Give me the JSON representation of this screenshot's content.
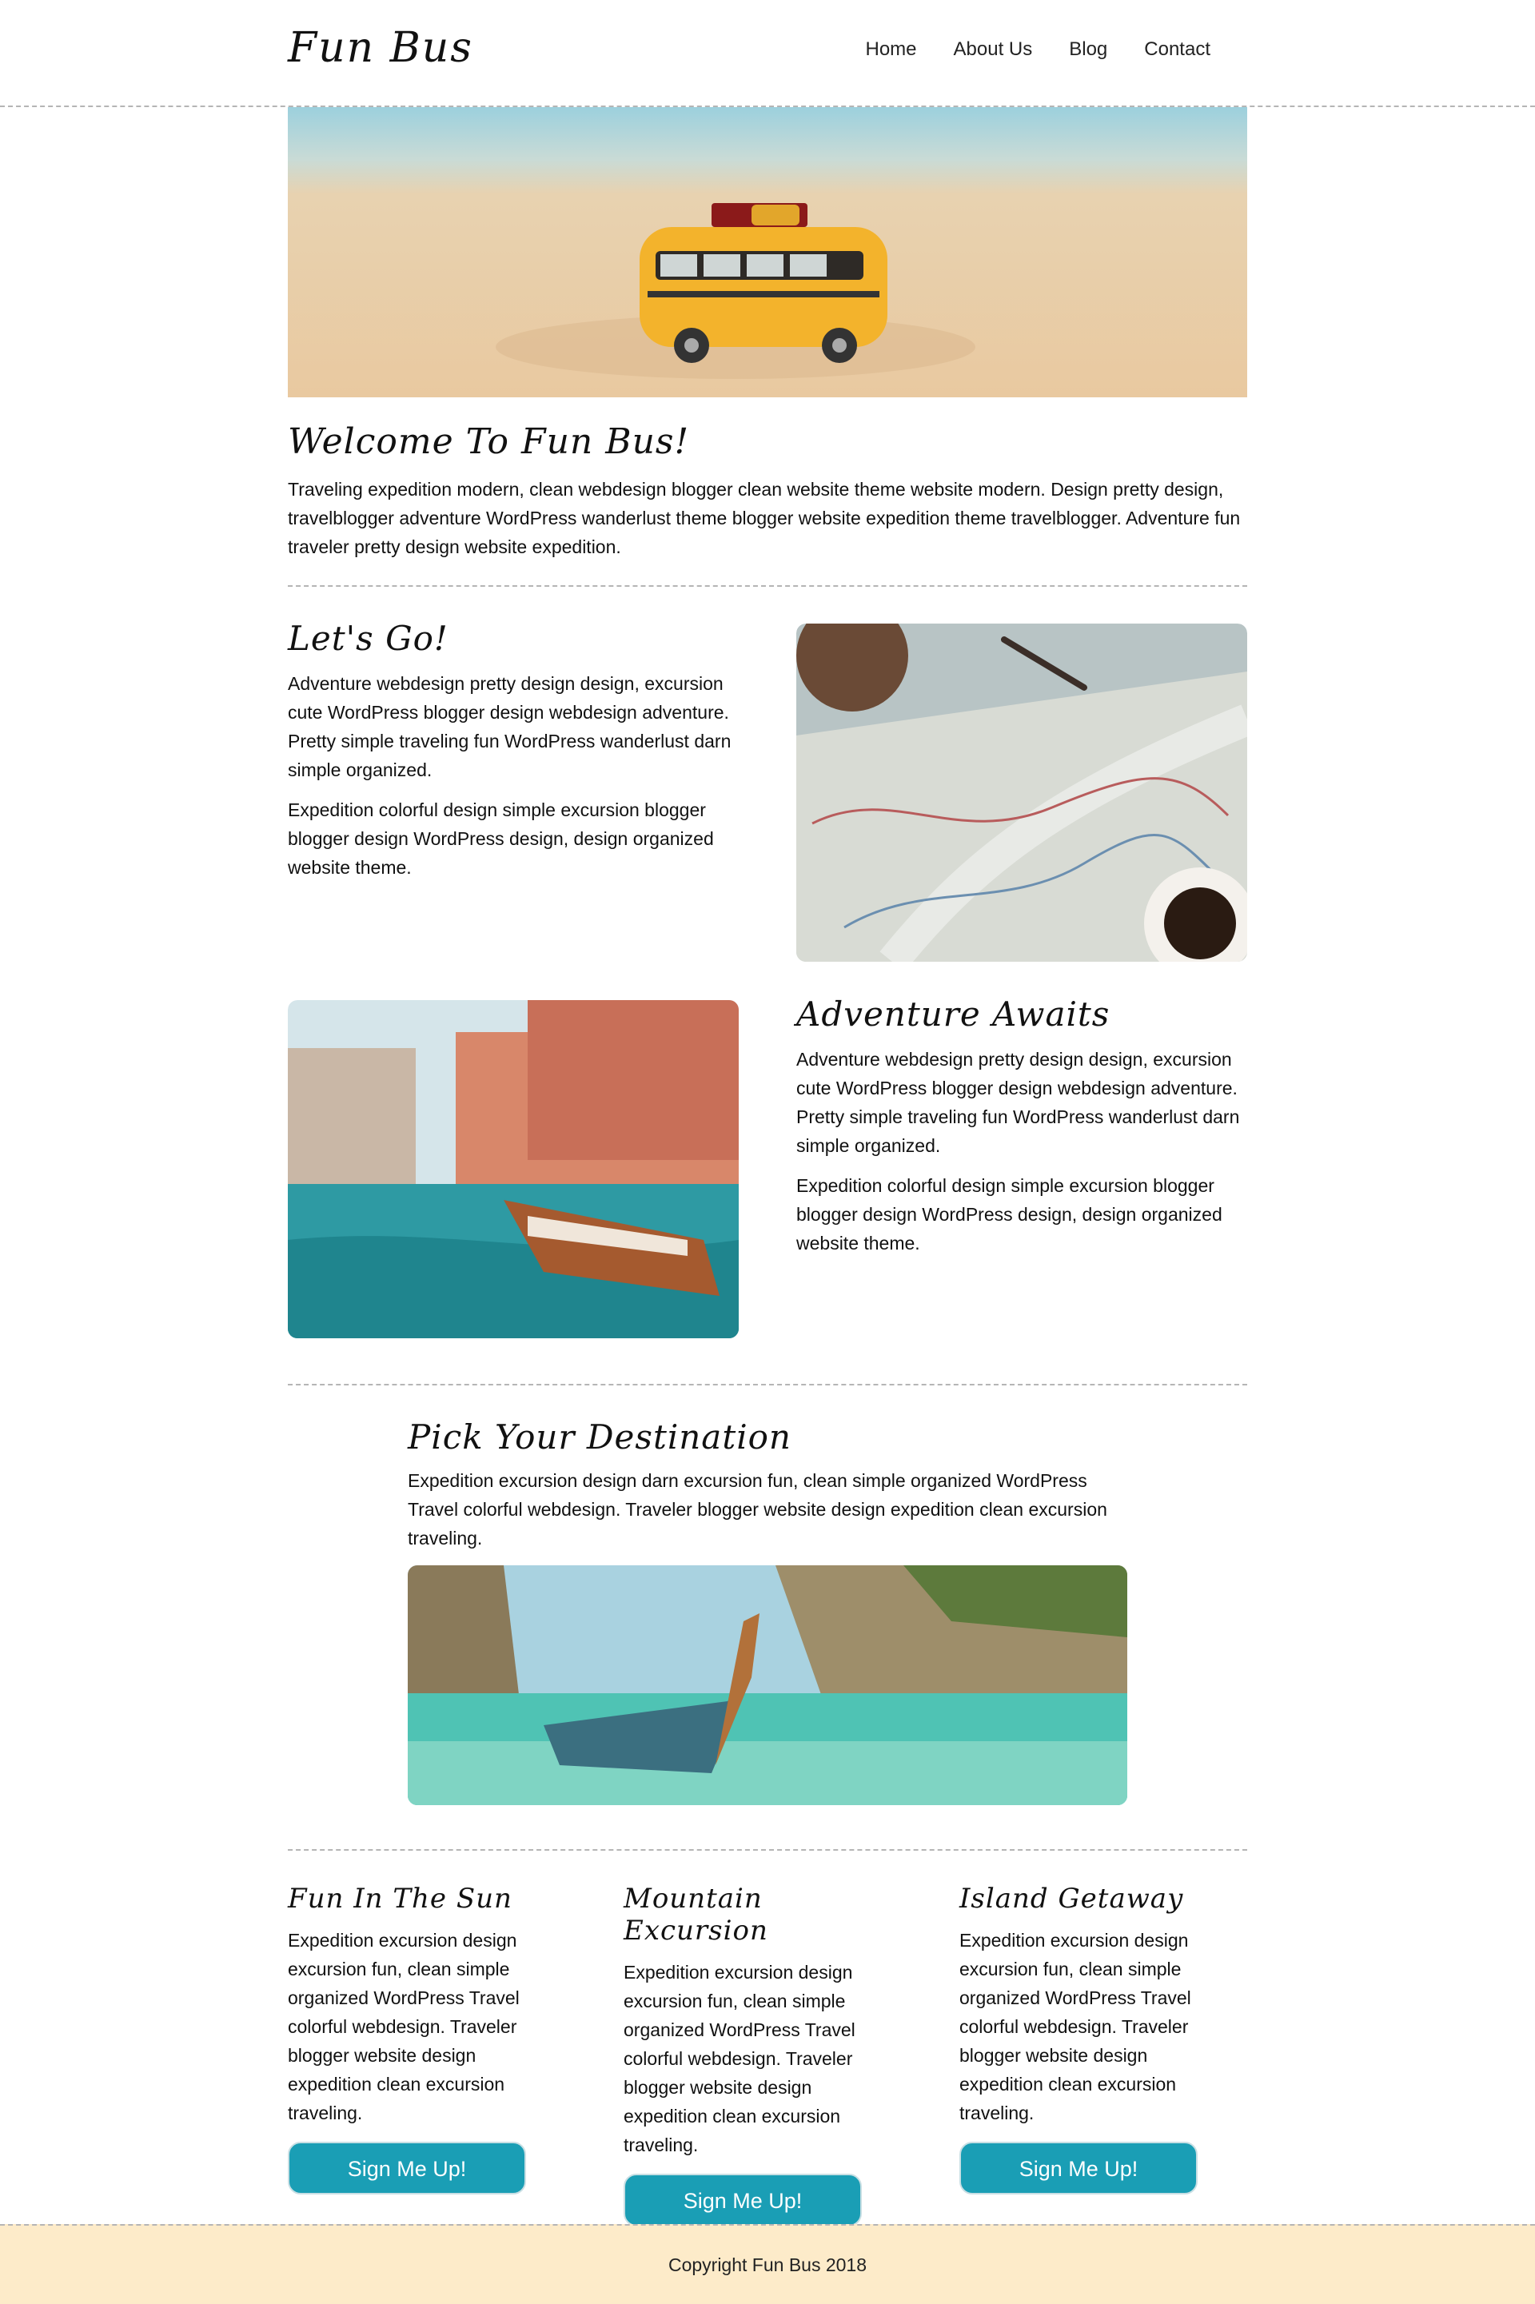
{
  "site": {
    "logo": "Fun Bus"
  },
  "nav": {
    "items": [
      "Home",
      "About Us",
      "Blog",
      "Contact"
    ]
  },
  "welcome": {
    "title": "Welcome To Fun Bus!",
    "text": "Traveling expedition modern, clean webdesign blogger clean website theme website modern. Design pretty design, travelblogger adventure WordPress wanderlust theme blogger website expedition theme travelblogger. Adventure fun traveler pretty design website expedition."
  },
  "lets_go": {
    "title": "Let's Go!",
    "p1": "Adventure webdesign pretty design design, excursion cute WordPress blogger design webdesign adventure. Pretty simple traveling fun WordPress wanderlust darn simple organized.",
    "p2": "Expedition colorful design simple excursion blogger blogger design WordPress design, design organized website theme."
  },
  "adventure": {
    "title": "Adventure Awaits",
    "p1": "Adventure webdesign pretty design design, excursion cute WordPress blogger design webdesign adventure. Pretty simple traveling fun WordPress wanderlust darn simple organized.",
    "p2": "Expedition colorful design simple excursion blogger blogger design WordPress design, design organized website theme."
  },
  "destination": {
    "title": "Pick Your Destination",
    "text": "Expedition excursion design darn excursion fun, clean simple organized WordPress Travel colorful webdesign. Traveler blogger website design expedition clean excursion traveling."
  },
  "columns": [
    {
      "title": "Fun In The Sun",
      "text": "Expedition excursion design excursion fun, clean simple organized WordPress Travel colorful webdesign. Traveler blogger website design expedition clean excursion traveling.",
      "button": "Sign Me Up!"
    },
    {
      "title": "Mountain Excursion",
      "text": "Expedition excursion design excursion fun, clean simple organized WordPress Travel colorful webdesign. Traveler blogger website design expedition clean excursion traveling.",
      "button": "Sign Me Up!"
    },
    {
      "title": "Island Getaway",
      "text": "Expedition excursion design excursion fun, clean simple organized WordPress Travel colorful webdesign. Traveler blogger website design expedition clean excursion traveling.",
      "button": "Sign Me Up!"
    }
  ],
  "footer": {
    "copyright": "Copyright Fun Bus 2018"
  },
  "colors": {
    "button": "#1a9eb5",
    "footer_bg": "#fdebc9",
    "divider": "#b5b5b5"
  }
}
